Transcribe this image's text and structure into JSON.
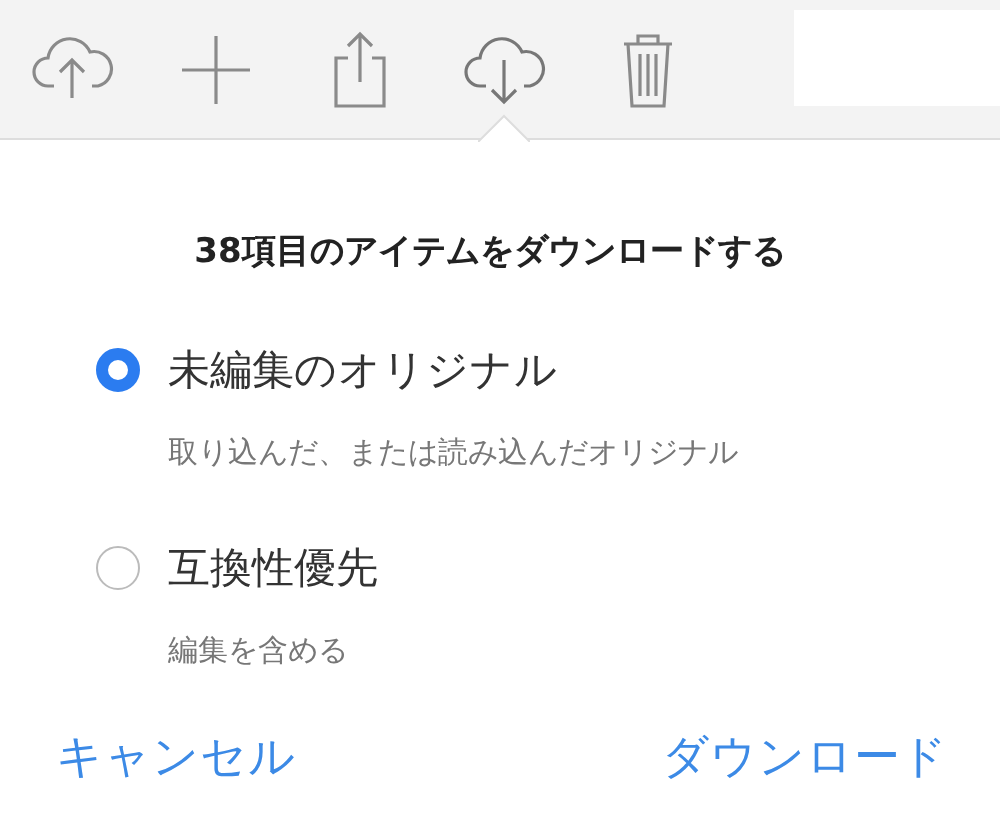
{
  "toolbar": {
    "icons": [
      {
        "selected": false
      },
      {
        "selected": false
      },
      {
        "selected": false
      },
      {
        "selected": true
      },
      {
        "selected": false
      }
    ]
  },
  "dialog": {
    "title": "38項目のアイテムをダウンロードする",
    "options": [
      {
        "label": "未編集のオリジナル",
        "description": "取り込んだ、または読み込んだオリジナル",
        "selected": true
      },
      {
        "label": "互換性優先",
        "description": "編集を含める",
        "selected": false
      }
    ],
    "buttons": [
      "キャンセル",
      "ダウンロード"
    ]
  }
}
